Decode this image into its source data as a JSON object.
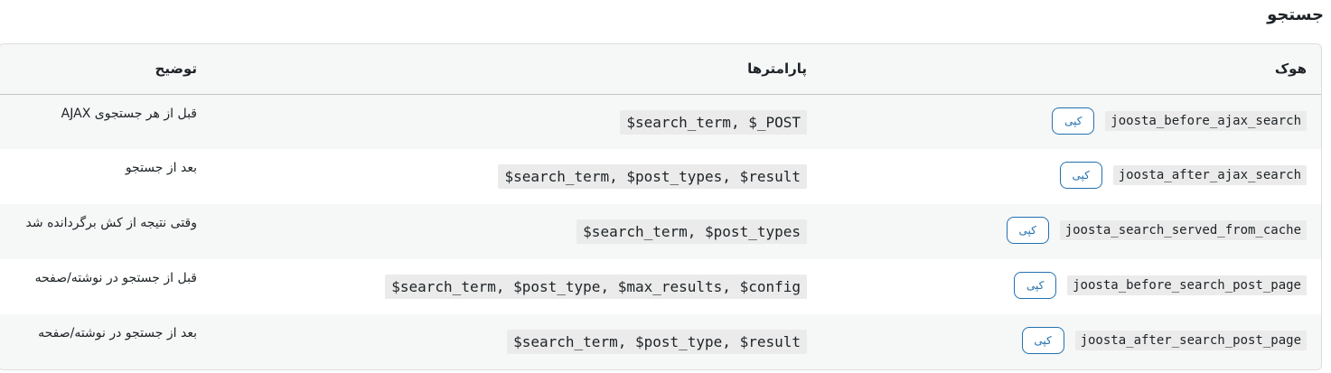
{
  "section": {
    "title": "جستجو"
  },
  "table": {
    "headers": {
      "hook": "هوک",
      "params": "پارامترها",
      "desc": "توضیح"
    },
    "rows": [
      {
        "hook": "joosta_before_ajax_search",
        "copy": "کپی",
        "params": "$search_term, $_POST",
        "desc": "قبل از هر جستجوی AJAX"
      },
      {
        "hook": "joosta_after_ajax_search",
        "copy": "کپی",
        "params": "$search_term, $post_types, $result",
        "desc": "بعد از جستجو"
      },
      {
        "hook": "joosta_search_served_from_cache",
        "copy": "کپی",
        "params": "$search_term, $post_types",
        "desc": "وقتی نتیجه از کش برگردانده شد"
      },
      {
        "hook": "joosta_before_search_post_page",
        "copy": "کپی",
        "params": "$search_term, $post_type, $max_results, $config",
        "desc": "قبل از جستجو در نوشته/صفحه"
      },
      {
        "hook": "joosta_after_search_post_page",
        "copy": "کپی",
        "params": "$search_term, $post_type, $result",
        "desc": "بعد از جستجو در نوشته/صفحه"
      }
    ]
  },
  "colors": {
    "accent": "#2271b1",
    "row_alt": "#f6f7f7",
    "code_bg": "#ebebeb"
  }
}
